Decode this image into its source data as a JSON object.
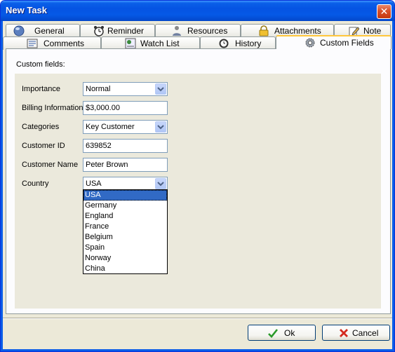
{
  "window": {
    "title": "New Task",
    "close_glyph": "✕"
  },
  "tabs_row1": [
    {
      "label": "General",
      "icon": "globe-icon"
    },
    {
      "label": "Reminder",
      "icon": "alarm-clock-icon"
    },
    {
      "label": "Resources",
      "icon": "person-icon"
    },
    {
      "label": "Attachments",
      "icon": "lock-icon"
    },
    {
      "label": "Note",
      "icon": "note-pencil-icon"
    }
  ],
  "tabs_row2": [
    {
      "label": "Comments",
      "icon": "comments-icon"
    },
    {
      "label": "Watch List",
      "icon": "watch-list-icon"
    },
    {
      "label": "History",
      "icon": "history-clock-icon"
    },
    {
      "label": "Custom Fields",
      "icon": "gear-icon",
      "active": true
    }
  ],
  "section_label": "Custom fields:",
  "fields": {
    "importance": {
      "label": "Importance",
      "value": "Normal"
    },
    "billing": {
      "label": "Billing Information",
      "value": "$3,000.00"
    },
    "categories": {
      "label": "Categories",
      "value": "Key Customer"
    },
    "customer_id": {
      "label": "Customer ID",
      "value": "639852"
    },
    "customer_name": {
      "label": "Customer Name",
      "value": "Peter Brown"
    },
    "country": {
      "label": "Country",
      "value": "USA"
    }
  },
  "country_options": [
    "USA",
    "Germany",
    "England",
    "France",
    "Belgium",
    "Spain",
    "Norway",
    "China"
  ],
  "country_selected": "USA",
  "buttons": {
    "ok": "Ok",
    "cancel": "Cancel"
  },
  "colors": {
    "titlebar": "#0554e3",
    "selection": "#316ac5",
    "tab_active_accent": "#ffc73c",
    "ok_check": "#2a9a2a",
    "cancel_x": "#d42a1e"
  }
}
